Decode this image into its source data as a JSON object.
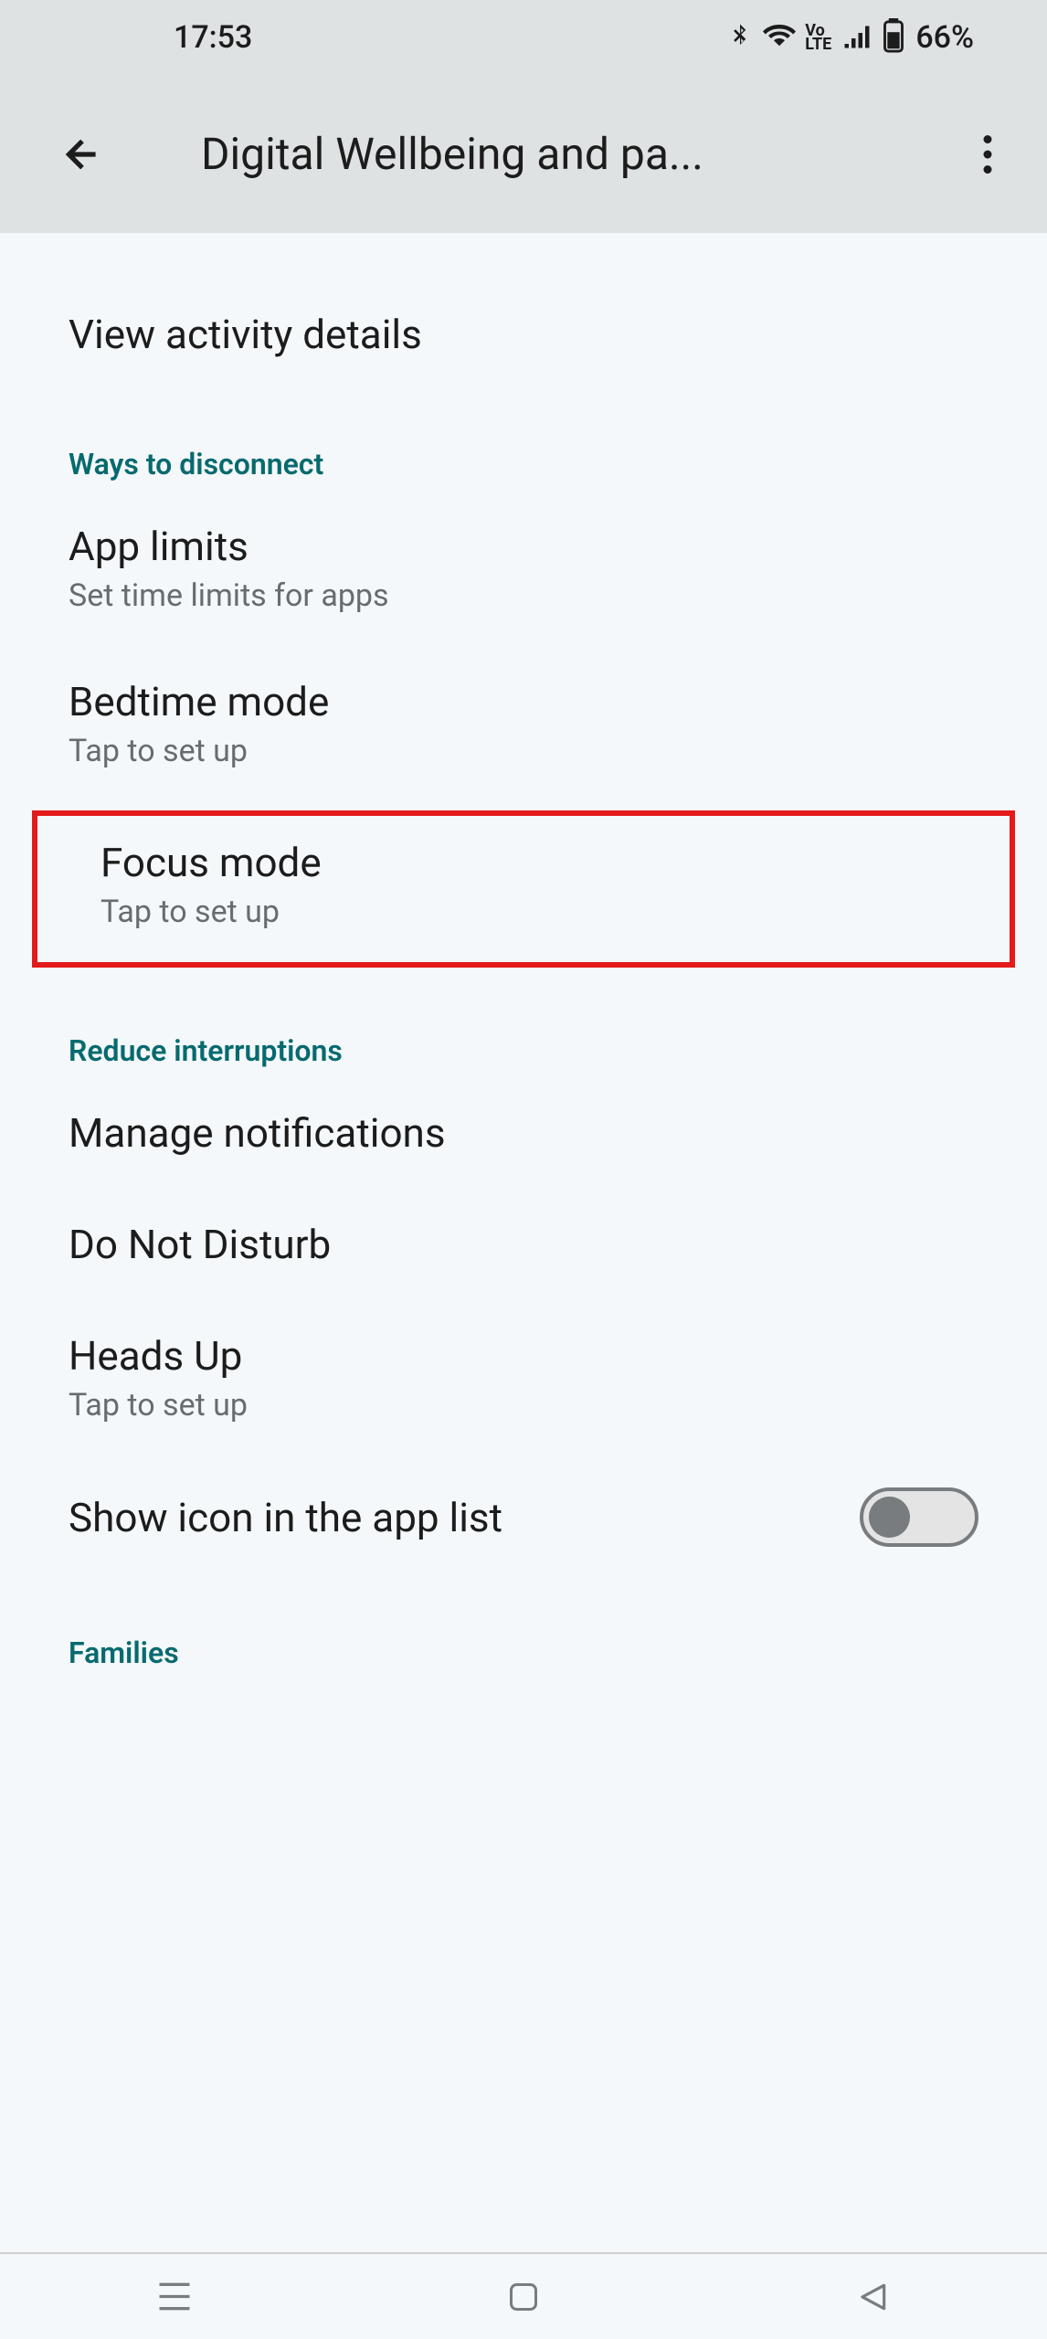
{
  "status": {
    "time": "17:53",
    "battery": "66%"
  },
  "header": {
    "title": "Digital Wellbeing and pa..."
  },
  "items": {
    "view_activity": {
      "title": "View activity details"
    }
  },
  "sections": {
    "disconnect": {
      "header": "Ways to disconnect",
      "app_limits": {
        "title": "App limits",
        "subtitle": "Set time limits for apps"
      },
      "bedtime": {
        "title": "Bedtime mode",
        "subtitle": "Tap to set up"
      },
      "focus": {
        "title": "Focus mode",
        "subtitle": "Tap to set up"
      }
    },
    "interruptions": {
      "header": "Reduce interruptions",
      "notifications": {
        "title": "Manage notifications"
      },
      "dnd": {
        "title": "Do Not Disturb"
      },
      "heads_up": {
        "title": "Heads Up",
        "subtitle": "Tap to set up"
      },
      "show_icon": {
        "title": "Show icon in the app list"
      }
    },
    "families": {
      "header": "Families"
    }
  }
}
